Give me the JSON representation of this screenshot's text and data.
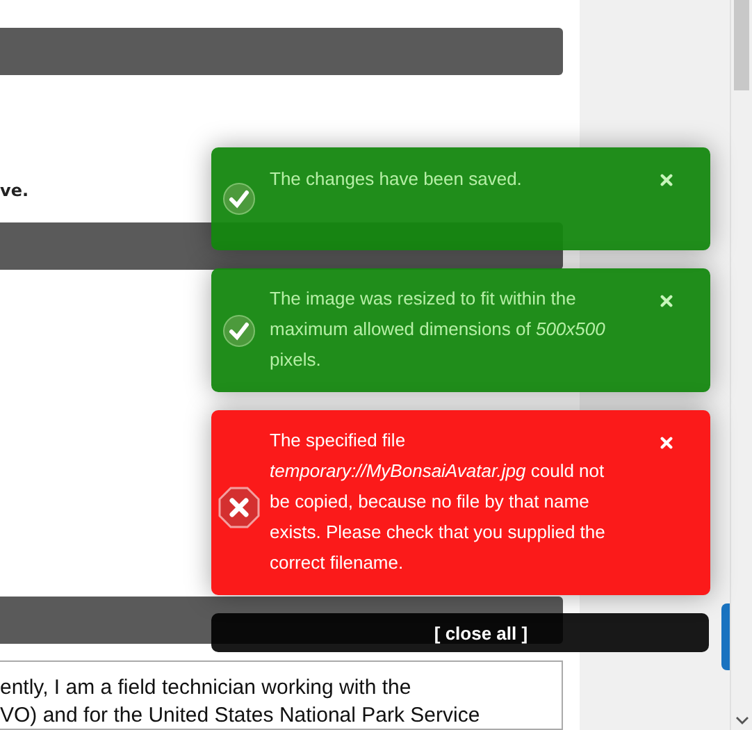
{
  "page": {
    "text_fragment": "ve.",
    "textarea_lines": [
      "ently, I am a field technician working with the",
      "VO) and for the United States National Park Service"
    ]
  },
  "notifications": [
    {
      "kind": "success",
      "message": "The changes have been saved."
    },
    {
      "kind": "success",
      "message": "The image was resized to fit within the maximum allowed dimensions of *500x500* pixels."
    },
    {
      "kind": "error",
      "message": "The specified file *temporary://MyBonsaiAvatar.jpg* could not be copied, because no file by that name exists. Please check that you supplied the correct filename."
    }
  ],
  "close_all": "[ close all ]"
}
